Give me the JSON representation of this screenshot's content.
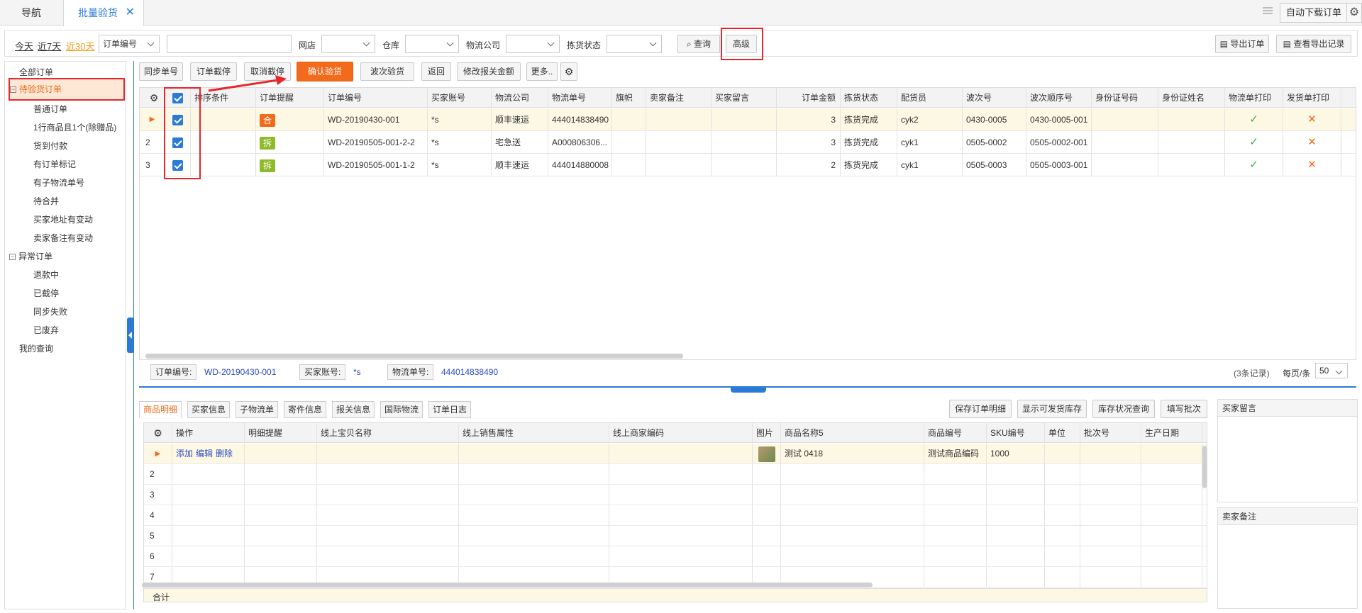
{
  "tabs": {
    "nav": "导航",
    "batch": "批量验货",
    "close": "✕"
  },
  "topbar": {
    "auto_download": "自动下载订单",
    "gear": "⚙"
  },
  "filter": {
    "today": "今天",
    "last7": "近7天",
    "last30": "近30天",
    "order_field": "订单编号",
    "store_label": "网店",
    "warehouse_label": "仓库",
    "logistics_label": "物流公司",
    "pick_status_label": "拣货状态",
    "query": "查询",
    "advanced": "高级",
    "export_orders": "导出订单",
    "view_export": "查看导出记录"
  },
  "sidebar": {
    "all": "全部订单",
    "pending": "待验货订单",
    "children": [
      "普通订单",
      "1行商品且1个(除赠品)",
      "货到付款",
      "有订单标记",
      "有子物流单号",
      "待合并",
      "买家地址有变动",
      "卖家备注有变动"
    ],
    "abnormal": "异常订单",
    "abnormal_children": [
      "退款中",
      "已截停",
      "同步失败",
      "已废弃"
    ],
    "my_query": "我的查询"
  },
  "toolbar": {
    "sync": "同步单号",
    "hold": "订单截停",
    "unhold": "取消截停",
    "confirm": "确认验货",
    "wave": "波次验货",
    "back": "返回",
    "modify": "修改报关金额",
    "more": "更多.."
  },
  "grid": {
    "headers": [
      "排序条件",
      "订单提醒",
      "订单编号",
      "买家账号",
      "物流公司",
      "物流单号",
      "旗帜",
      "卖家备注",
      "买家留言",
      "订单金额",
      "拣货状态",
      "配货员",
      "波次号",
      "波次顺序号",
      "身份证号码",
      "身份证姓名",
      "物流单打印",
      "发货单打印"
    ],
    "rows": [
      {
        "idx": "▶",
        "tag": "合",
        "order": "WD-20190430-001",
        "buyer": "*s",
        "company": "顺丰速运",
        "tracking": "444014838490",
        "amount": "3",
        "status": "拣货完成",
        "picker": "cyk2",
        "wave": "0430-0005",
        "wave_seq": "0430-0005-001",
        "print1": "✓",
        "print2": "✕"
      },
      {
        "idx": "2",
        "tag": "拆",
        "order": "WD-20190505-001-2-2",
        "buyer": "*s",
        "company": "宅急送",
        "tracking": "A000806306...",
        "amount": "3",
        "status": "拣货完成",
        "picker": "cyk1",
        "wave": "0505-0002",
        "wave_seq": "0505-0002-001",
        "print1": "✓",
        "print2": "✕"
      },
      {
        "idx": "3",
        "tag": "拆",
        "order": "WD-20190505-001-1-2",
        "buyer": "*s",
        "company": "顺丰速运",
        "tracking": "444014880008",
        "amount": "2",
        "status": "拣货完成",
        "picker": "cyk1",
        "wave": "0505-0003",
        "wave_seq": "0505-0003-001",
        "print1": "✓",
        "print2": "✕"
      }
    ]
  },
  "footer": {
    "order_label": "订单编号:",
    "order_value": "WD-20190430-001",
    "buyer_label": "买家账号:",
    "buyer_value": "*s",
    "tracking_label": "物流单号:",
    "tracking_value": "444014838490",
    "records": "(3条记录)",
    "per_page": "每页/条",
    "page_size": "50"
  },
  "bottom_tabs": [
    "商品明细",
    "买家信息",
    "子物流单",
    "寄件信息",
    "报关信息",
    "国际物流",
    "订单日志"
  ],
  "bottom_actions": {
    "save": "保存订单明细",
    "show_stock": "显示可发货库存",
    "stock_query": "库存状况查询",
    "batch": "填写批次"
  },
  "detail": {
    "headers": [
      "操作",
      "明细提醒",
      "线上宝贝名称",
      "线上销售属性",
      "线上商家编码",
      "图片",
      "商品名称5",
      "商品编号",
      "SKU编号",
      "单位",
      "批次号",
      "生产日期"
    ],
    "row": {
      "idx": "▶",
      "add": "添加",
      "edit": "编辑",
      "del": "删除",
      "name": "测试 0418",
      "code": "测试商品编码",
      "sku": "1000"
    },
    "row_numbers": [
      "2",
      "3",
      "4",
      "5",
      "6",
      "7"
    ],
    "total": "合计"
  },
  "panels": {
    "buyer_msg": "买家留言",
    "seller_note": "卖家备注"
  },
  "colors": {
    "accent": "#2b7bd6",
    "confirm": "#f26a1b",
    "highlight": "#e8262b"
  }
}
